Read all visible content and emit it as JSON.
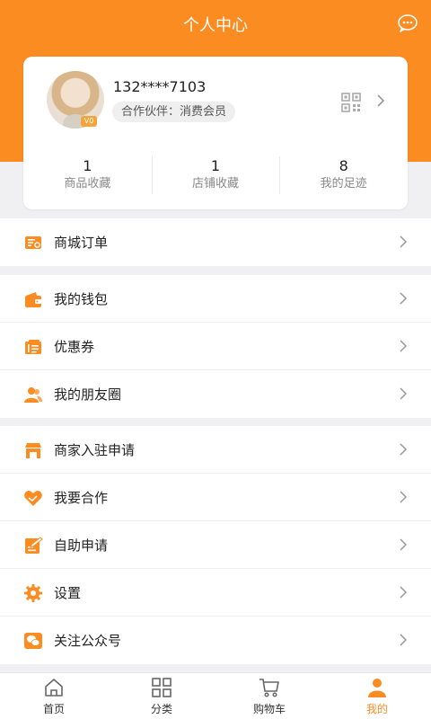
{
  "header": {
    "title": "个人中心",
    "message_icon": "chat-bubble-icon"
  },
  "profile": {
    "phone": "132****7103",
    "member_tag": "合作伙伴：消费会员",
    "vip_badge": "V0",
    "qr_icon": "qr-code-icon"
  },
  "stats": [
    {
      "value": "1",
      "label": "商品收藏"
    },
    {
      "value": "1",
      "label": "店铺收藏"
    },
    {
      "value": "8",
      "label": "我的足迹"
    }
  ],
  "menu": {
    "orders": {
      "label": "商城订单",
      "icon": "order-list-icon"
    },
    "wallet": {
      "label": "我的钱包",
      "icon": "wallet-icon"
    },
    "coupons": {
      "label": "优惠券",
      "icon": "coupon-icon"
    },
    "friends": {
      "label": "我的朋友圈",
      "icon": "friends-icon"
    },
    "merchant": {
      "label": "商家入驻申请",
      "icon": "store-icon"
    },
    "cooperate": {
      "label": "我要合作",
      "icon": "handshake-icon"
    },
    "self_apply": {
      "label": "自助申请",
      "icon": "application-form-icon"
    },
    "settings": {
      "label": "设置",
      "icon": "gear-icon"
    },
    "follow": {
      "label": "关注公众号",
      "icon": "wechat-icon"
    }
  },
  "tabbar": {
    "home": "首页",
    "category": "分类",
    "cart": "购物车",
    "mine": "我的"
  },
  "colors": {
    "accent": "#fb8c22",
    "background": "#f0f0f2"
  }
}
